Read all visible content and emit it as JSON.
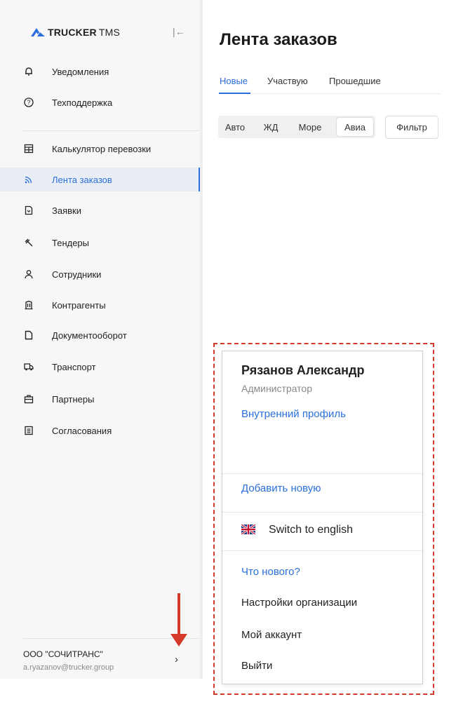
{
  "logo": {
    "brand": "TRUCKER",
    "suffix": "TMS"
  },
  "sidebar": {
    "collapse_symbol": "|←",
    "items": [
      {
        "label": "Уведомления",
        "icon": "bell-icon"
      },
      {
        "label": "Техподдержка",
        "icon": "help-circle-icon"
      },
      {
        "label": "Калькулятор перевозки",
        "icon": "calculator-icon"
      },
      {
        "label": "Лента заказов",
        "icon": "rss-icon",
        "active": true
      },
      {
        "label": "Заявки",
        "icon": "document-request-icon"
      },
      {
        "label": "Тендеры",
        "icon": "gavel-icon"
      },
      {
        "label": "Сотрудники",
        "icon": "user-icon"
      },
      {
        "label": "Контрагенты",
        "icon": "building-icon"
      },
      {
        "label": "Документооборот",
        "icon": "file-icon"
      },
      {
        "label": "Транспорт",
        "icon": "truck-icon"
      },
      {
        "label": "Партнеры",
        "icon": "briefcase-icon"
      },
      {
        "label": "Согласования",
        "icon": "approval-list-icon"
      }
    ],
    "org": "ООО \"СОЧИТРАНС\"",
    "email": "a.ryazanov@trucker.group",
    "org_chevron": "›"
  },
  "main": {
    "title": "Лента заказов",
    "tabs": [
      {
        "label": "Новые",
        "active": true
      },
      {
        "label": "Участвую"
      },
      {
        "label": "Прошедшие"
      }
    ],
    "transport_filters": [
      "Авто",
      "ЖД",
      "Море",
      "Авиа"
    ],
    "selected_filter": "Авиа",
    "filter_button": "Фильтр"
  },
  "profile_menu": {
    "name": "Рязанов Александр",
    "role": "Администратор",
    "internal_profile": "Внутренний профиль",
    "add_new": "Добавить новую",
    "switch_language": "Switch to english",
    "whats_new": "Что нового?",
    "org_settings": "Настройки организации",
    "my_account": "Мой аккаунт",
    "logout": "Выйти"
  },
  "colors": {
    "accent": "#2a6fdb",
    "annotation": "#d43a2b",
    "sidebar_bg": "#f7f7f8"
  }
}
